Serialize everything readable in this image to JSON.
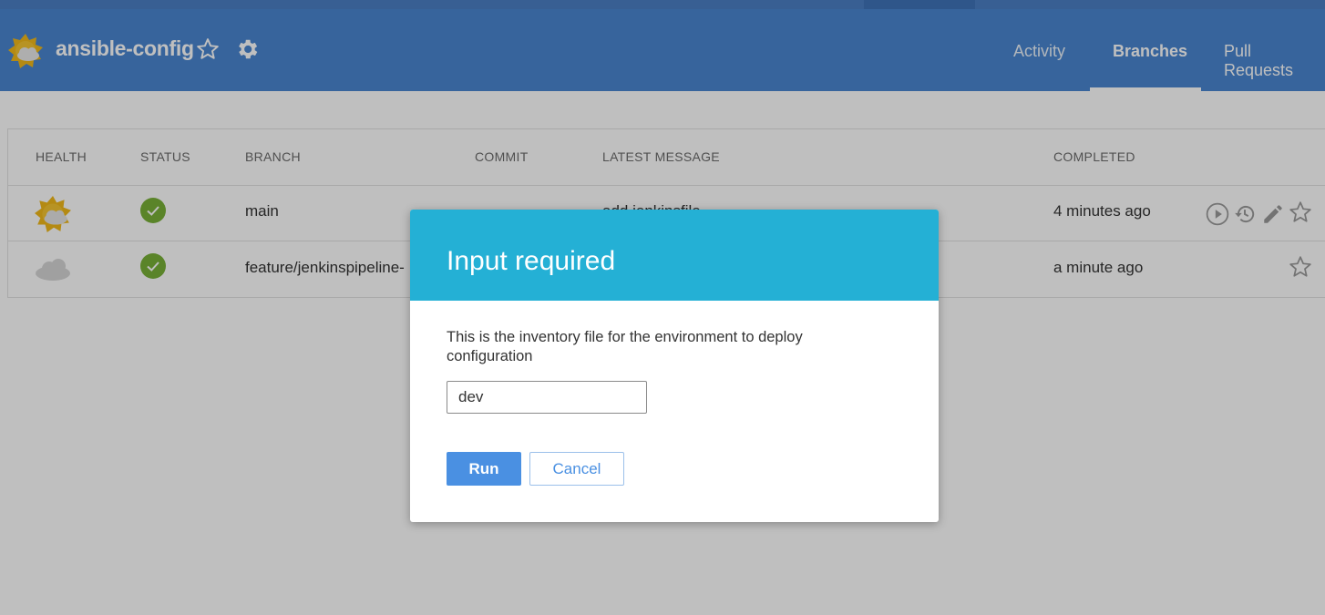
{
  "header": {
    "project_title": "ansible-config",
    "tabs": [
      {
        "label": "Activity"
      },
      {
        "label": "Branches",
        "active": true
      },
      {
        "label": "Pull Requests"
      }
    ]
  },
  "table": {
    "columns": [
      "HEALTH",
      "STATUS",
      "BRANCH",
      "COMMIT",
      "LATEST MESSAGE",
      "COMPLETED"
    ],
    "rows": [
      {
        "health": "sunny-cloud-icon",
        "status": "success",
        "branch": "main",
        "commit": "",
        "message": "add jenkinsfile",
        "completed": "4 minutes ago"
      },
      {
        "health": "cloud-icon",
        "status": "success",
        "branch": "feature/jenkinspipeline-",
        "commit": "",
        "message": "",
        "completed": "a minute ago"
      }
    ]
  },
  "modal": {
    "title": "Input required",
    "message": "This is the inventory file for the environment to deploy configuration",
    "input_value": "dev",
    "run_label": "Run",
    "cancel_label": "Cancel"
  },
  "colors": {
    "header_bg": "#4a86d0",
    "modal_header_bg": "#24b0d5",
    "primary_button": "#4a90e2",
    "success_green": "#78b037"
  }
}
